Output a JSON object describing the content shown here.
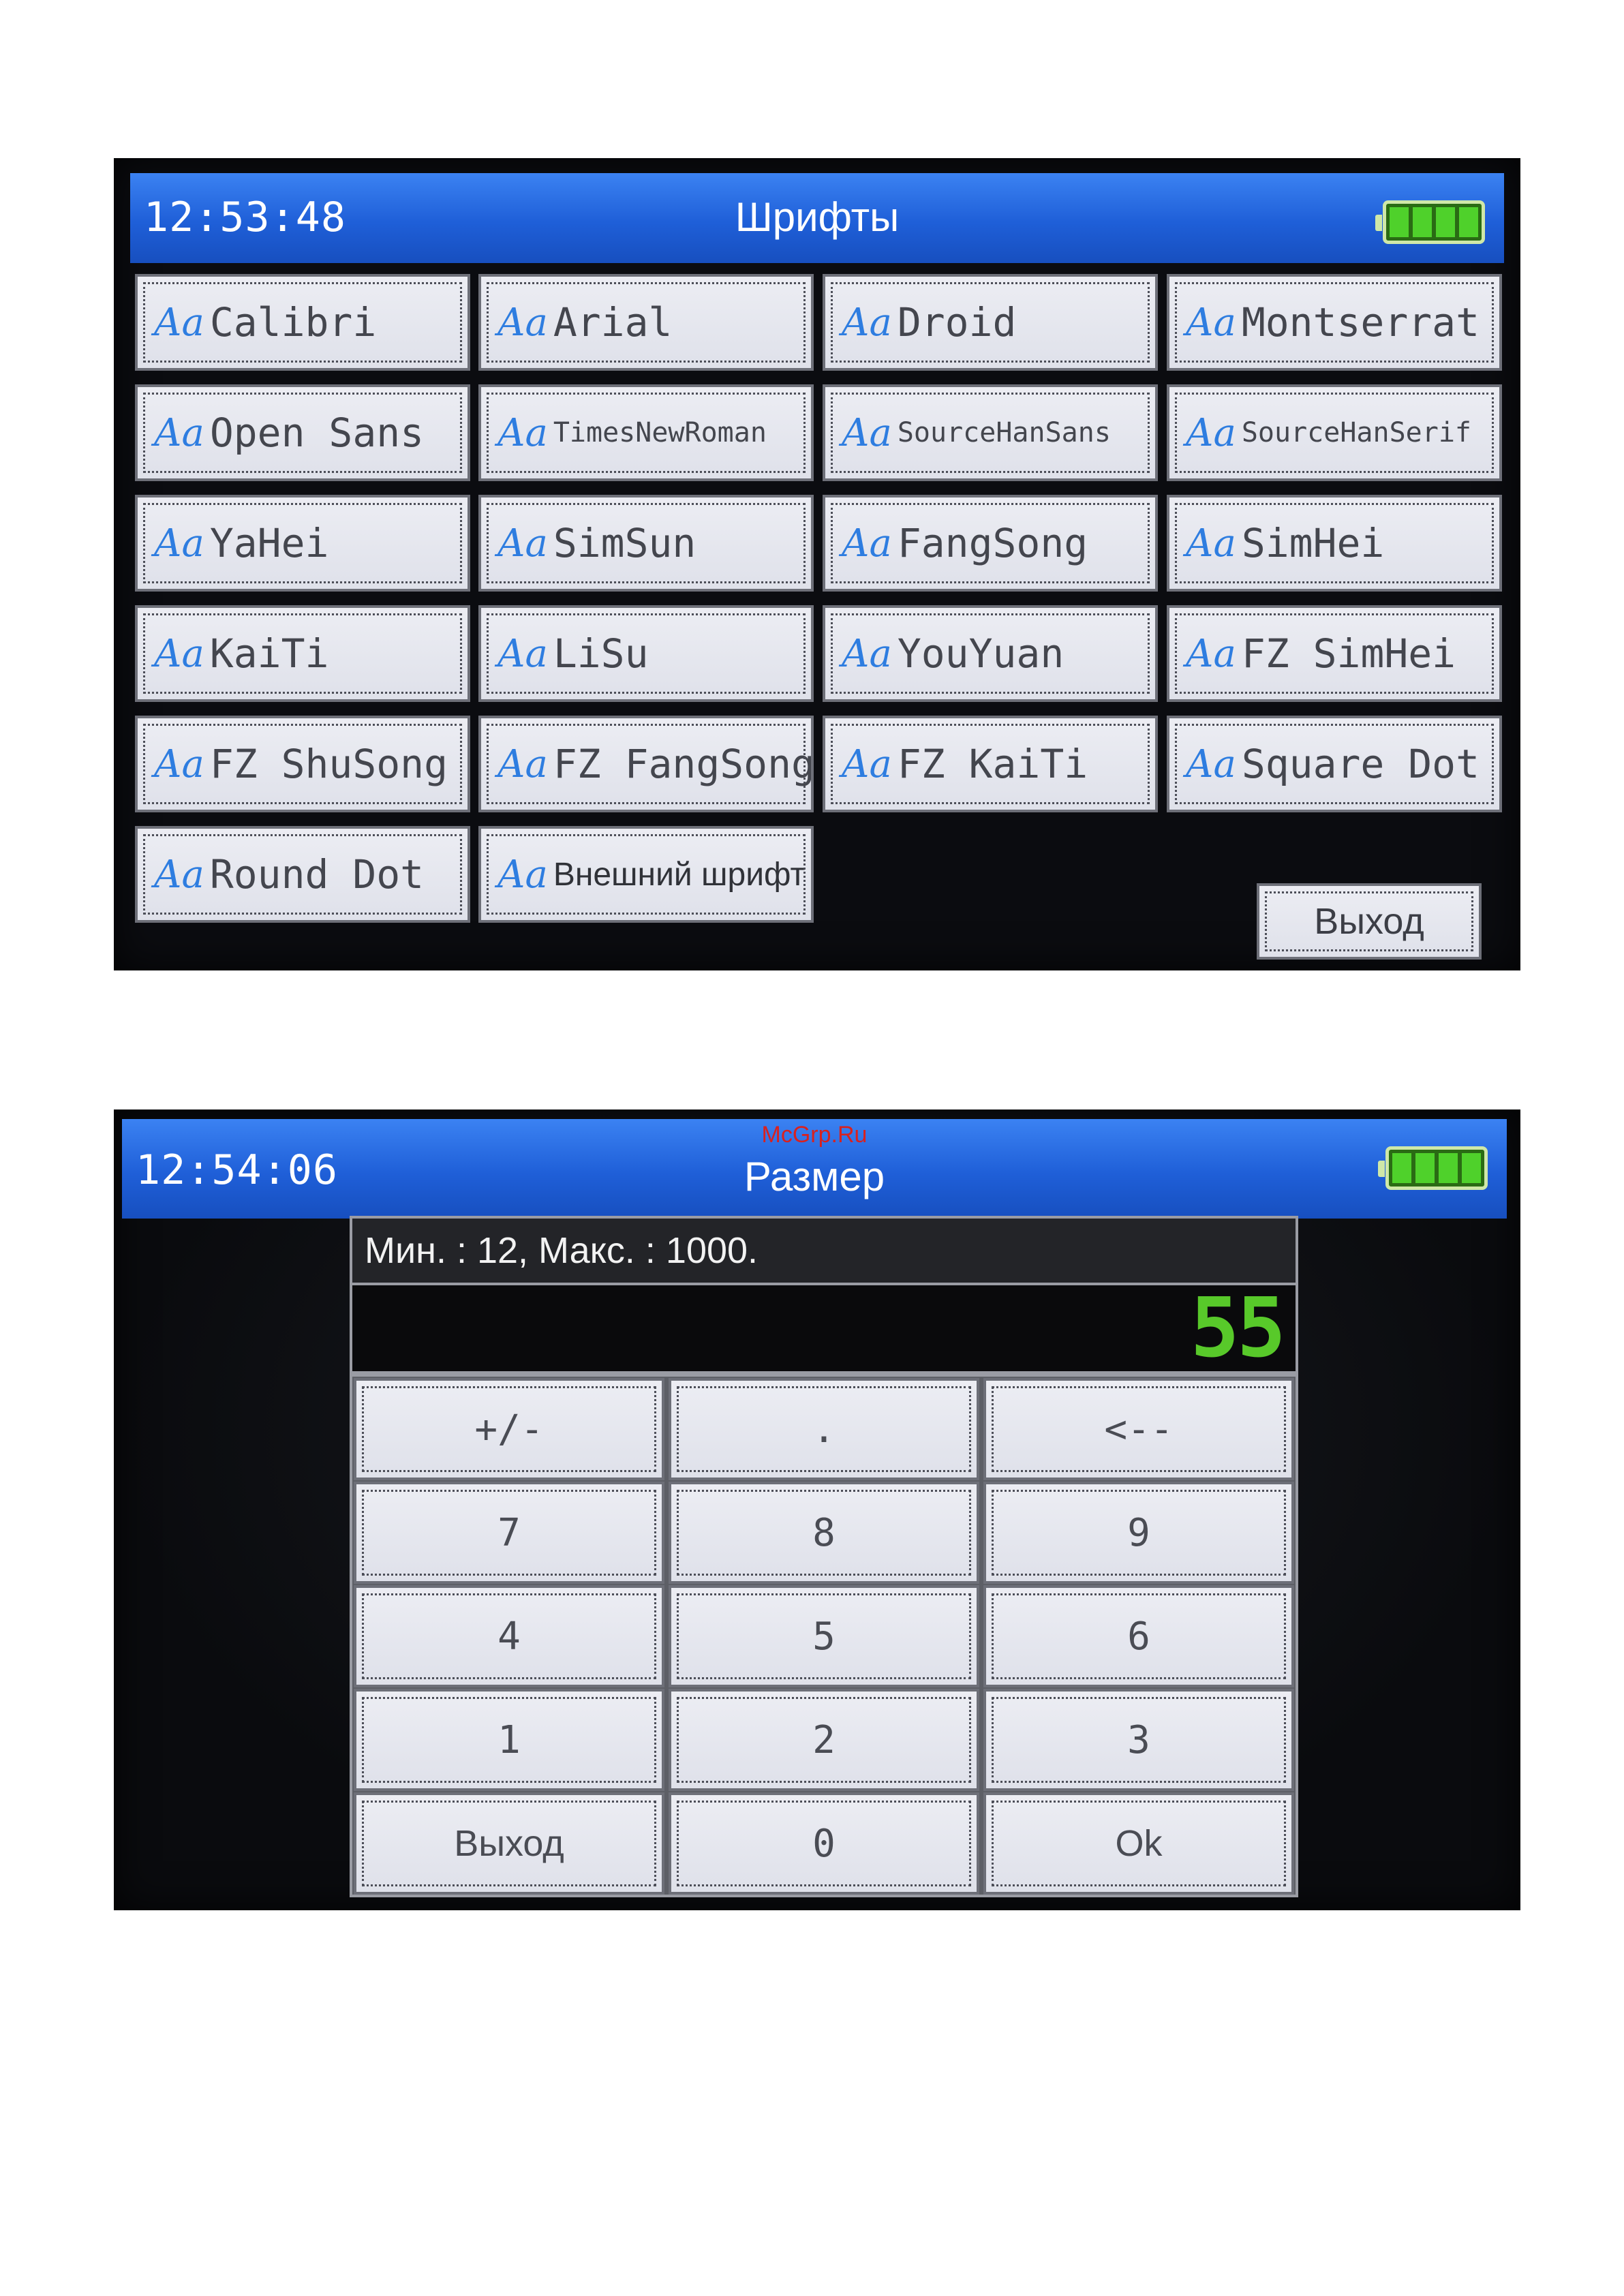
{
  "fonts_screen": {
    "time": "12:53:48",
    "title": "Шрифты",
    "aa_label": "Aa",
    "fonts": [
      "Calibri",
      "Arial",
      "Droid",
      "Montserrat",
      "Open Sans",
      "TimesNewRoman",
      "SourceHanSans",
      "SourceHanSerif",
      "YaHei",
      "SimSun",
      "FangSong",
      "SimHei",
      "KaiTi",
      "LiSu",
      "YouYuan",
      "FZ SimHei",
      "FZ ShuSong",
      "FZ FangSong",
      "FZ KaiTi",
      "Square Dot",
      "Round Dot",
      "Внешний шрифт"
    ],
    "exit_label": "Выход"
  },
  "size_screen": {
    "time": "12:54:06",
    "watermark": "McGrp.Ru",
    "title": "Размер",
    "range_text": "Мин. : 12,  Макс. : 1000.",
    "value": "55",
    "keys": [
      "+/-",
      ".",
      "<--",
      "7",
      "8",
      "9",
      "4",
      "5",
      "6",
      "1",
      "2",
      "3",
      "Выход",
      "0",
      "Ok"
    ]
  },
  "colors": {
    "titlebar": "#1f5fd8",
    "accent_aa": "#2e7de0",
    "display_digits": "#58c92a",
    "battery": "#4fd12b"
  }
}
